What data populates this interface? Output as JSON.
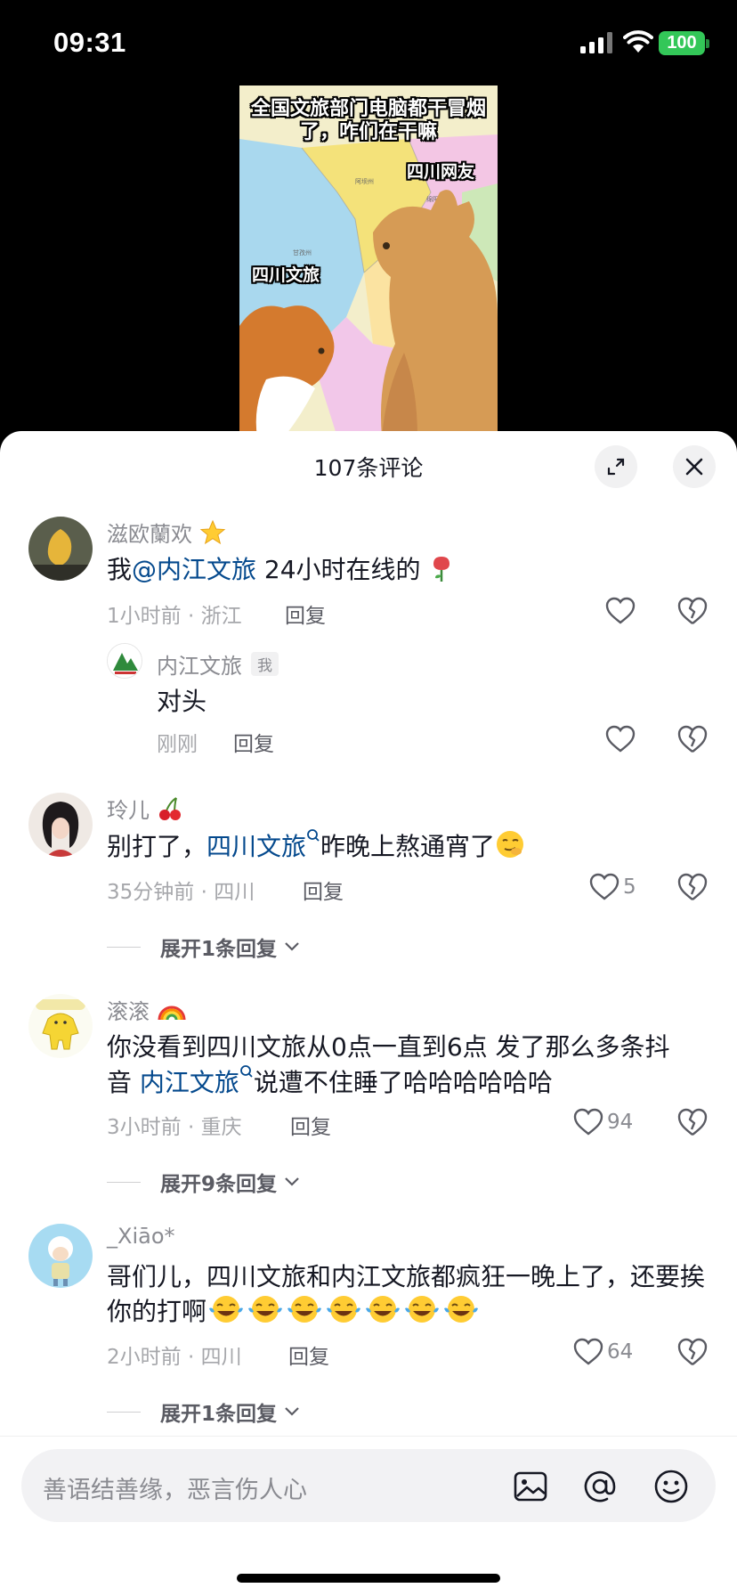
{
  "status": {
    "time": "09:31",
    "battery": "100"
  },
  "video": {
    "caption": "全国文旅部门电脑都干冒烟了，咋们在干嘛",
    "label_netizen": "四川网友",
    "label_sichuan": "四川文旅"
  },
  "sheet": {
    "title": "107条评论"
  },
  "comments": [
    {
      "username": "滋欧蘭欢",
      "mention": "@内江文旅",
      "text_before": "我",
      "text_after": " 24小时在线的",
      "time_location": "1小时前 · 浙江",
      "reply_label": "回复",
      "reply": {
        "username": "内江文旅",
        "badge": "我",
        "text": "对头",
        "time": "刚刚",
        "reply_label": "回复"
      }
    },
    {
      "username": "玲儿",
      "text_before": "别打了，",
      "mention": "四川文旅",
      "text_after": "昨晚上熬通宵了",
      "time_location": "35分钟前 · 四川",
      "reply_label": "回复",
      "likes": "5",
      "expand": "展开1条回复"
    },
    {
      "username": "滚滚",
      "text_before": "你没看到四川文旅从0点一直到6点 发了那么多条抖音 ",
      "mention": "内江文旅",
      "text_after": "说遭不住睡了哈哈哈哈哈哈",
      "time_location": "3小时前 · 重庆",
      "reply_label": "回复",
      "likes": "94",
      "expand": "展开9条回复"
    },
    {
      "username": "_Xiāo*",
      "text": "哥们儿，四川文旅和内江文旅都疯狂一晚上了，还要挨你的打啊",
      "time_location": "2小时前 · 四川",
      "reply_label": "回复",
      "likes": "64",
      "expand": "展开1条回复"
    }
  ],
  "input": {
    "placeholder": "善语结善缘，恶言伤人心"
  },
  "colors": {
    "mention": "#04498d",
    "battery": "#33c758"
  }
}
